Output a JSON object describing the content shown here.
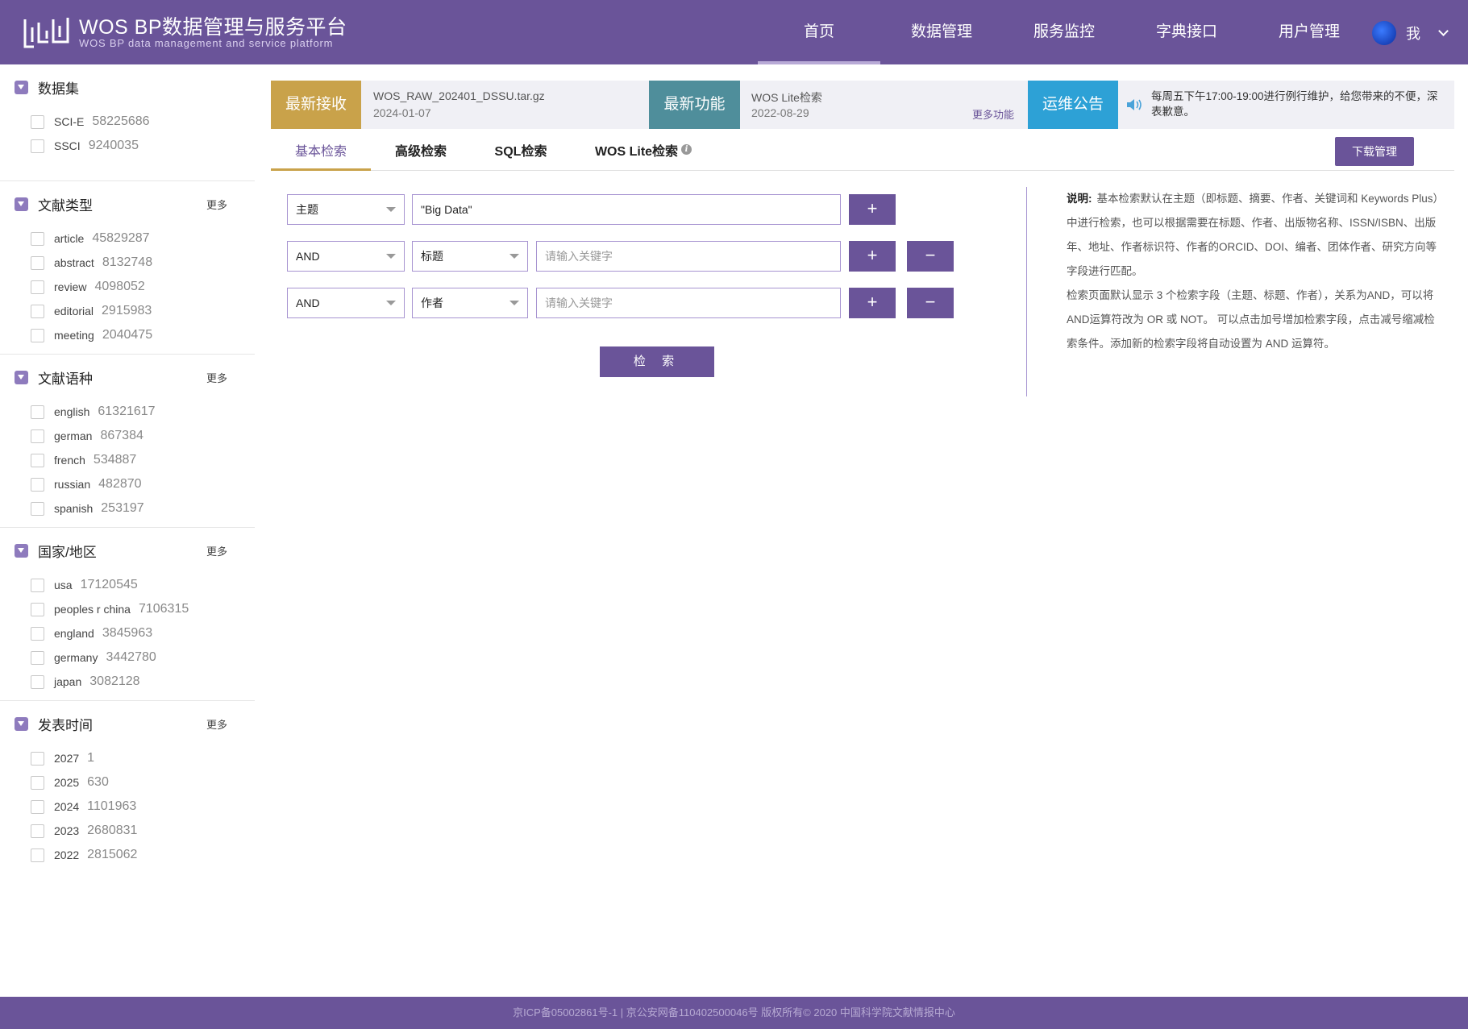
{
  "header": {
    "title": "WOS BP数据管理与服务平台",
    "subtitle": "WOS BP  data management and service platform",
    "nav": [
      "首页",
      "数据管理",
      "服务监控",
      "字典接口",
      "用户管理"
    ],
    "active_nav": "首页",
    "user_label": "我"
  },
  "sidebar": {
    "more_label": "更多",
    "facets": [
      {
        "title": "数据集",
        "has_more": false,
        "items": [
          {
            "name": "SCI-E",
            "count": "58225686"
          },
          {
            "name": "SSCI",
            "count": "9240035"
          }
        ]
      },
      {
        "title": "文献类型",
        "has_more": true,
        "items": [
          {
            "name": "article",
            "count": "45829287"
          },
          {
            "name": "abstract",
            "count": "8132748"
          },
          {
            "name": "review",
            "count": "4098052"
          },
          {
            "name": "editorial",
            "count": "2915983"
          },
          {
            "name": "meeting",
            "count": "2040475"
          }
        ]
      },
      {
        "title": "文献语种",
        "has_more": true,
        "items": [
          {
            "name": "english",
            "count": "61321617"
          },
          {
            "name": "german",
            "count": "867384"
          },
          {
            "name": "french",
            "count": "534887"
          },
          {
            "name": "russian",
            "count": "482870"
          },
          {
            "name": "spanish",
            "count": "253197"
          }
        ]
      },
      {
        "title": "国家/地区",
        "has_more": true,
        "items": [
          {
            "name": "usa",
            "count": "17120545"
          },
          {
            "name": "peoples r china",
            "count": "7106315"
          },
          {
            "name": "england",
            "count": "3845963"
          },
          {
            "name": "germany",
            "count": "3442780"
          },
          {
            "name": "japan",
            "count": "3082128"
          }
        ]
      },
      {
        "title": "发表时间",
        "has_more": true,
        "items": [
          {
            "name": "2027",
            "count": "1"
          },
          {
            "name": "2025",
            "count": "630"
          },
          {
            "name": "2024",
            "count": "1101963"
          },
          {
            "name": "2023",
            "count": "2680831"
          },
          {
            "name": "2022",
            "count": "2815062"
          }
        ]
      }
    ]
  },
  "infobar": {
    "latest_receive": {
      "label": "最新接收",
      "file": "WOS_RAW_202401_DSSU.tar.gz",
      "date": "2024-01-07"
    },
    "latest_feature": {
      "label": "最新功能",
      "name": "WOS Lite检索",
      "date": "2022-08-29",
      "more": "更多功能"
    },
    "notice": {
      "label": "运维公告",
      "text": "每周五下午17:00-19:00进行例行维护，给您带来的不便，深表歉意。"
    }
  },
  "tabs": {
    "items": [
      "基本检索",
      "高级检索",
      "SQL检索",
      "WOS Lite检索"
    ],
    "active": "基本检索",
    "info_icon": "i",
    "download_label": "下载管理"
  },
  "search": {
    "rows": [
      {
        "operator": "",
        "field": "主题",
        "value": "\"Big Data\"",
        "placeholder": "请输入关键字",
        "removable": false
      },
      {
        "operator": "AND",
        "field": "标题",
        "value": "",
        "placeholder": "请输入关键字",
        "removable": true
      },
      {
        "operator": "AND",
        "field": "作者",
        "value": "",
        "placeholder": "请输入关键字",
        "removable": true
      }
    ],
    "add_symbol": "+",
    "remove_symbol": "−",
    "submit_label": "检 索"
  },
  "help": {
    "label": "说明:",
    "p1": "基本检索默认在主题（即标题、摘要、作者、关键词和 Keywords Plus）中进行检索，也可以根据需要在标题、作者、出版物名称、ISSN/ISBN、出版年、地址、作者标识符、作者的ORCID、DOI、编者、团体作者、研究方向等字段进行匹配。",
    "p2": "检索页面默认显示 3 个检索字段（主题、标题、作者），关系为AND，可以将 AND运算符改为 OR 或 NOT。 可以点击加号增加检索字段，点击减号缩减检索条件。添加新的检索字段将自动设置为 AND 运算符。"
  },
  "footer": {
    "text": "京ICP备05002861号-1 | 京公安网备110402500046号 版权所有© 2020 中国科学院文献情报中心"
  },
  "colors": {
    "brand": "#6a5499",
    "receive": "#c9a24a",
    "feature": "#4f8e9b",
    "notice": "#2da1d6"
  }
}
